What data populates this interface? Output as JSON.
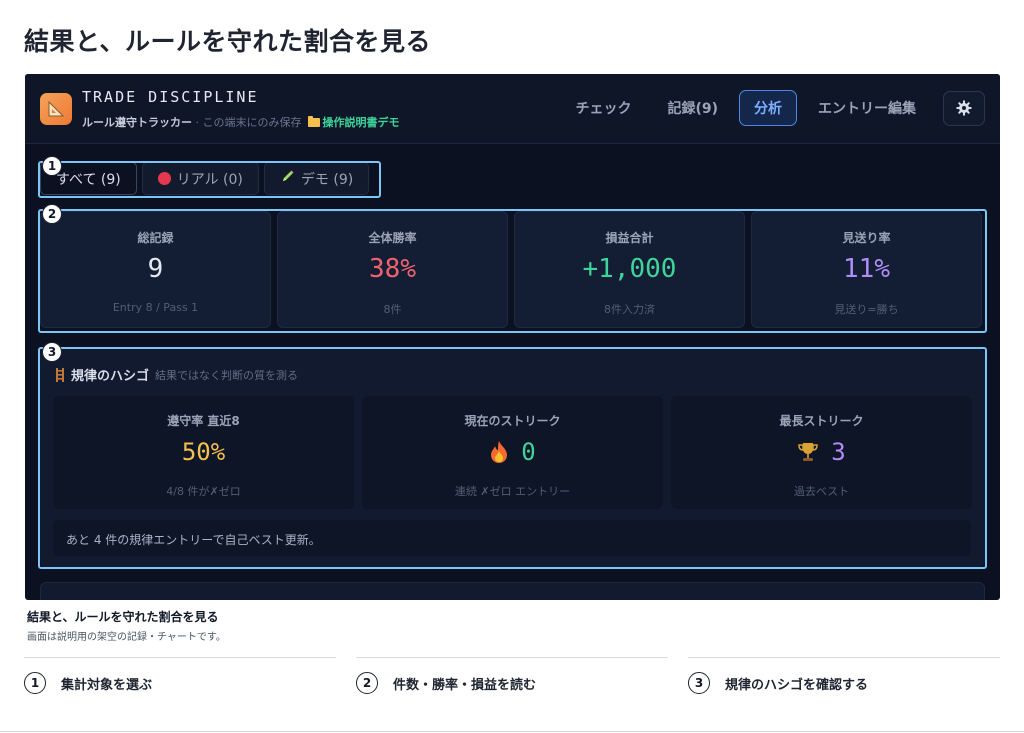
{
  "page": {
    "heading": "結果と、ルールを守れた割合を見る"
  },
  "app": {
    "brand_title": "TRADE DISCIPLINE",
    "brand_sub_name": "ルール遵守トラッカー",
    "brand_sub_note": " · この端末にのみ保存",
    "brand_sub_folder": "操作説明書デモ",
    "nav": {
      "check": "チェック",
      "records": "記録(9)",
      "analysis": "分析",
      "entry_edit": "エントリー編集"
    },
    "settings_icon": "gear-icon"
  },
  "filters": {
    "all": "すべて (9)",
    "real": "リアル (0)",
    "demo": "デモ (9)"
  },
  "stats": [
    {
      "label": "総記録",
      "value": "9",
      "sub": "Entry 8 / Pass 1",
      "color": "#e5e9f2"
    },
    {
      "label": "全体勝率",
      "value": "38%",
      "sub": "8件",
      "color": "#f0626e"
    },
    {
      "label": "損益合計",
      "value": "+1,000",
      "sub": "8件入力済",
      "color": "#3fd49a"
    },
    {
      "label": "見送り率",
      "value": "11%",
      "sub": "見送り=勝ち",
      "color": "#b08cf7"
    }
  ],
  "ladder": {
    "title": "規律のハシゴ",
    "subtitle": "結果ではなく判断の質を測る",
    "cards": [
      {
        "label": "遵守率 直近8",
        "value": "50%",
        "sub": "4/8 件が✗ゼロ",
        "color": "#f5c04d"
      },
      {
        "label": "現在のストリーク",
        "value": "0",
        "sub": "連続 ✗ゼロ エントリー",
        "color": "#3fd49a"
      },
      {
        "label": "最長ストリーク",
        "value": "3",
        "sub": "過去ベスト",
        "color": "#b08cf7"
      }
    ],
    "note": "あと 4 件の規律エントリーで自己ベスト更新。"
  },
  "markers": [
    "1",
    "2",
    "3"
  ],
  "caption": {
    "title": "結果と、ルールを守れた割合を見る",
    "subtitle": "画面は説明用の架空の記録・チャートです。"
  },
  "steps": [
    {
      "num": "1",
      "text": "集計対象を選ぶ"
    },
    {
      "num": "2",
      "text": "件数・勝率・損益を読む"
    },
    {
      "num": "3",
      "text": "規律のハシゴを確認する"
    }
  ]
}
